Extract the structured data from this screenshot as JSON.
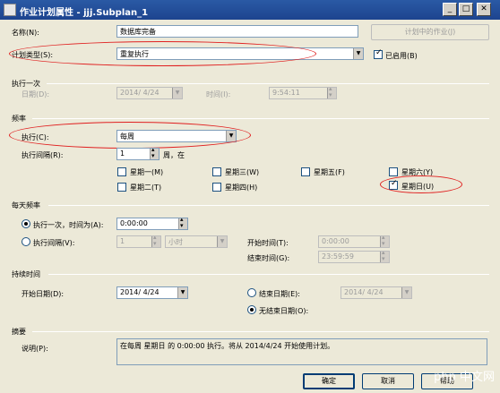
{
  "window": {
    "title": "作业计划属性 - jjj.Subplan_1",
    "tab_hint_left": "说明",
    "tab_hint_right": "说明"
  },
  "name": {
    "label": "名称(N):",
    "value": "数据库完备"
  },
  "jobs_button": {
    "label": "计划中的作业(J)"
  },
  "schedule_type": {
    "label": "计划类型(S):",
    "value": "重复执行"
  },
  "enabled": {
    "label": "已启用(B)",
    "checked": true
  },
  "one_time": {
    "section": "执行一次",
    "date_label": "日期(D):",
    "date_value": "2014/ 4/24",
    "time_label": "时间(I):",
    "time_value": "9:54:11"
  },
  "frequency": {
    "section": "频率",
    "occurs_label": "执行(C):",
    "occurs_value": "每周",
    "recurs_label": "执行间隔(R):",
    "recurs_value": "1",
    "recurs_unit": "周，在",
    "days": [
      {
        "label": "星期一(M)",
        "checked": false
      },
      {
        "label": "星期三(W)",
        "checked": false
      },
      {
        "label": "星期五(F)",
        "checked": false
      },
      {
        "label": "星期六(Y)",
        "checked": false
      },
      {
        "label": "星期二(T)",
        "checked": false
      },
      {
        "label": "星期四(H)",
        "checked": false
      },
      {
        "label": "星期日(U)",
        "checked": true
      }
    ]
  },
  "daily": {
    "section": "每天频率",
    "once_label": "执行一次，时间为(A):",
    "once_value": "0:00:00",
    "every_label": "执行间隔(V):",
    "every_value": "1",
    "every_unit": "小时",
    "start_label": "开始时间(T):",
    "start_value": "0:00:00",
    "end_label": "结束时间(G):",
    "end_value": "23:59:59"
  },
  "duration": {
    "section": "持续时间",
    "start_label": "开始日期(D):",
    "start_value": "2014/ 4/24",
    "end_label": "结束日期(E):",
    "end_value": "2014/ 4/24",
    "no_end_label": "无结束日期(O):"
  },
  "summary": {
    "section": "摘要",
    "desc_label": "说明(P):",
    "desc_value": "在每周 星期日 的 0:00:00 执行。将从 2014/4/24 开始使用计划。"
  },
  "buttons": {
    "ok": "确定",
    "cancel": "取消",
    "help": "帮助"
  },
  "watermark": "php 中文网"
}
